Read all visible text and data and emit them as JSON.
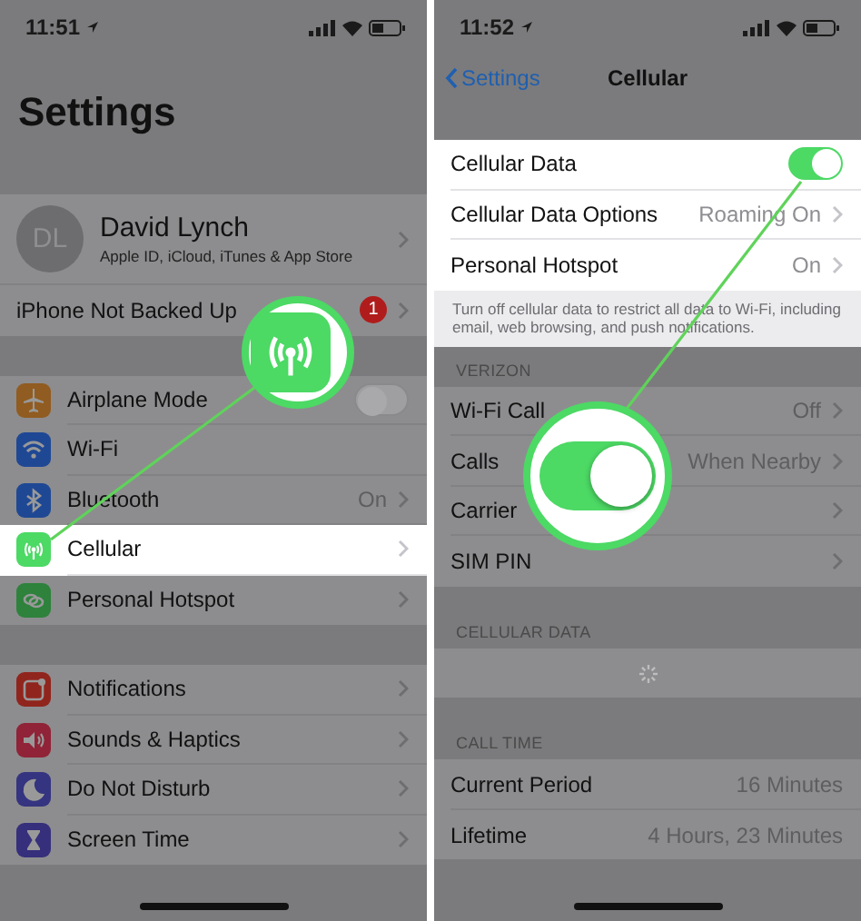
{
  "screens": [
    {
      "status_bar": {
        "time": "11:51"
      },
      "large_title": "Settings",
      "groups": [
        {
          "rows": [
            {
              "kind": "profile",
              "initials": "DL",
              "name": "David Lynch",
              "subtitle": "Apple ID, iCloud, iTunes & App Store",
              "selected": false,
              "chevron": true
            },
            {
              "kind": "plain",
              "label": "iPhone Not Backed Up",
              "badge": "1",
              "selected": false,
              "chevron": true
            }
          ]
        },
        {
          "rows": [
            {
              "kind": "airplane",
              "label": "Airplane Mode",
              "on": false,
              "selected": false,
              "chevron": false
            },
            {
              "kind": "wifi",
              "label": "Wi-Fi",
              "selected": false,
              "chevron": false
            },
            {
              "kind": "bluetooth",
              "label": "Bluetooth",
              "value": "On",
              "selected": false,
              "chevron": true
            },
            {
              "kind": "cellular",
              "label": "Cellular",
              "selected": true,
              "chevron": true
            },
            {
              "kind": "hotspot",
              "label": "Personal Hotspot",
              "selected": false,
              "chevron": true
            }
          ]
        },
        {
          "rows": [
            {
              "kind": "notifications",
              "label": "Notifications",
              "selected": false,
              "chevron": true
            },
            {
              "kind": "sounds",
              "label": "Sounds & Haptics",
              "selected": false,
              "chevron": true
            },
            {
              "kind": "moon",
              "label": "Do Not Disturb",
              "selected": false,
              "chevron": true
            },
            {
              "kind": "hourglass",
              "label": "Screen Time",
              "selected": false,
              "chevron": true
            }
          ]
        }
      ],
      "callout": {
        "kind": "cellular"
      }
    },
    {
      "status_bar": {
        "time": "11:52"
      },
      "nav": {
        "back": "Settings",
        "title": "Cellular"
      },
      "groups": [
        {
          "rows": [
            {
              "kind": "plain",
              "label": "Cellular Data",
              "on": true,
              "selected": true,
              "chevron": false
            },
            {
              "kind": "plain",
              "label": "Cellular Data Options",
              "value": "Roaming On",
              "selected": true,
              "chevron": true
            },
            {
              "kind": "plain",
              "label": "Personal Hotspot",
              "value": "On",
              "selected": true,
              "chevron": true
            }
          ],
          "note": {
            "text": "Turn off cellular data to restrict all data to Wi-Fi, including email, web browsing, and push notifications.",
            "dimmed": false
          }
        },
        {
          "header": "VERIZON",
          "rows": [
            {
              "kind": "plain",
              "label": "Wi-Fi Call",
              "value": "Off",
              "selected": false,
              "chevron": true
            },
            {
              "kind": "plain",
              "label": "Calls",
              "value": "When Nearby",
              "selected": false,
              "chevron": true
            },
            {
              "kind": "plain",
              "label": "Carrier",
              "selected": false,
              "chevron": true
            },
            {
              "kind": "plain",
              "label": "SIM PIN",
              "selected": false,
              "chevron": true
            }
          ]
        },
        {
          "header": "CELLULAR DATA",
          "rows": [
            {
              "kind": "spinner",
              "selected": false
            }
          ]
        },
        {
          "header": "CALL TIME",
          "rows": [
            {
              "kind": "plain",
              "label": "Current Period",
              "value": "16 Minutes",
              "selected": false,
              "chevron": false
            },
            {
              "kind": "plain",
              "label": "Lifetime",
              "value": "4 Hours, 23 Minutes",
              "selected": false,
              "chevron": false
            }
          ]
        }
      ],
      "callout": {
        "kind": "toggle",
        "on": true
      }
    }
  ]
}
